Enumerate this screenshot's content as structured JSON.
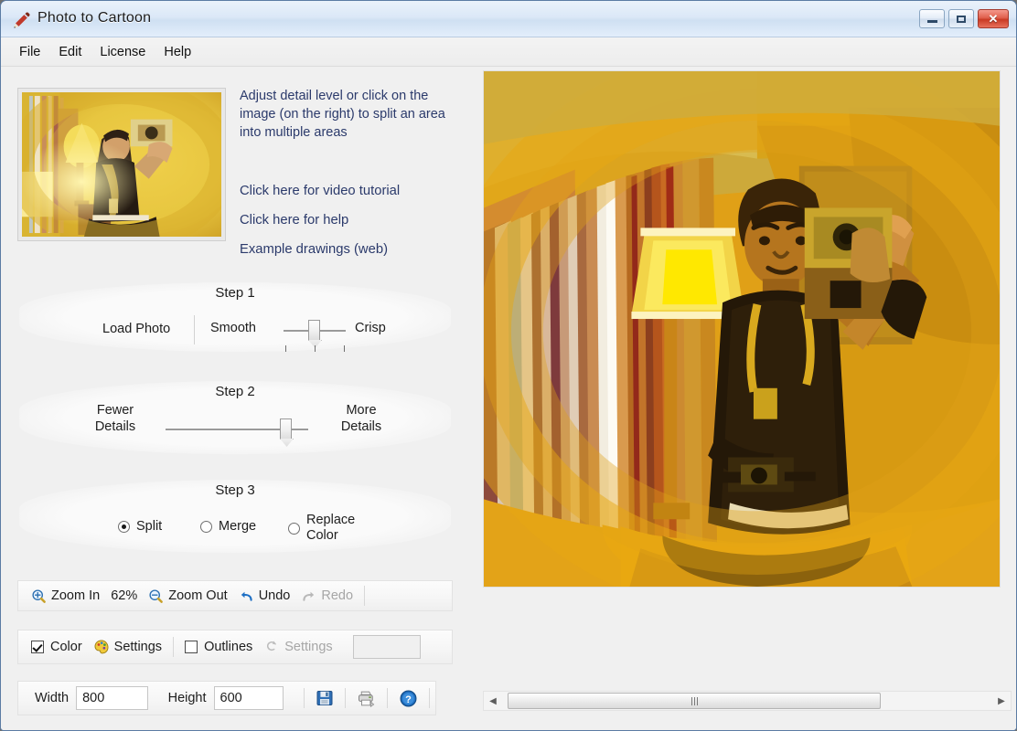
{
  "window": {
    "title": "Photo to Cartoon",
    "app_icon": "pencil-icon",
    "minimize_label": "–",
    "maximize_label": "□",
    "close_label": "✕"
  },
  "menu": {
    "items": [
      {
        "label": "File"
      },
      {
        "label": "Edit"
      },
      {
        "label": "License"
      },
      {
        "label": "Help"
      }
    ]
  },
  "instructions": {
    "text": "Adjust detail level or click on the image (on the right) to split an area into multiple areas"
  },
  "links": [
    {
      "label": "Click here for video tutorial"
    },
    {
      "label": "Click here for help"
    },
    {
      "label": "Example drawings (web)"
    }
  ],
  "step1": {
    "title": "Step 1",
    "load_photo_label": "Load Photo",
    "left_label": "Smooth",
    "right_label": "Crisp",
    "value_percent": 52,
    "tick_count": 3
  },
  "step2": {
    "title": "Step 2",
    "left_label_line1": "Fewer",
    "left_label_line2": "Details",
    "right_label_line1": "More",
    "right_label_line2": "Details",
    "value_percent": 78
  },
  "step3": {
    "title": "Step 3",
    "options": [
      {
        "label": "Split",
        "selected": true
      },
      {
        "label": "Merge",
        "selected": false
      },
      {
        "label": "Replace Color",
        "label_line1": "Replace",
        "label_line2": "Color",
        "selected": false
      }
    ]
  },
  "zoom_toolbar": {
    "zoom_in_label": "Zoom In",
    "zoom_in_icon": "magnifier-plus-icon",
    "zoom_level": "62%",
    "zoom_out_label": "Zoom Out",
    "zoom_out_icon": "magnifier-minus-icon",
    "undo_label": "Undo",
    "undo_icon": "undo-arrow-icon",
    "undo_enabled": true,
    "redo_label": "Redo",
    "redo_icon": "redo-arrow-icon",
    "redo_enabled": false
  },
  "render_toolbar": {
    "color_label": "Color",
    "color_checked": true,
    "color_settings_label": "Settings",
    "color_settings_icon": "palette-icon",
    "outlines_label": "Outlines",
    "outlines_checked": false,
    "outlines_settings_label": "Settings",
    "outlines_settings_icon": "outline-circle-icon",
    "outlines_settings_enabled": false,
    "preview_box_value": ""
  },
  "size_toolbar": {
    "width_label": "Width",
    "width_value": "800",
    "height_label": "Height",
    "height_value": "600",
    "save_icon": "floppy-save-icon",
    "print_icon": "printer-icon",
    "help_icon": "help-question-icon"
  },
  "scrollbar": {
    "left_arrow": "◀",
    "right_arrow": "▶",
    "grip": "|||"
  },
  "colors": {
    "link_text": "#2b3a6b",
    "title_text": "#1c1c1c",
    "disabled_text": "#a6a6a6",
    "accent_blue": "#1e6fc4",
    "close_red": "#c93a24",
    "image_amber": "#e0a017",
    "image_gold": "#d8b43a",
    "image_dark": "#2a1d0c"
  }
}
